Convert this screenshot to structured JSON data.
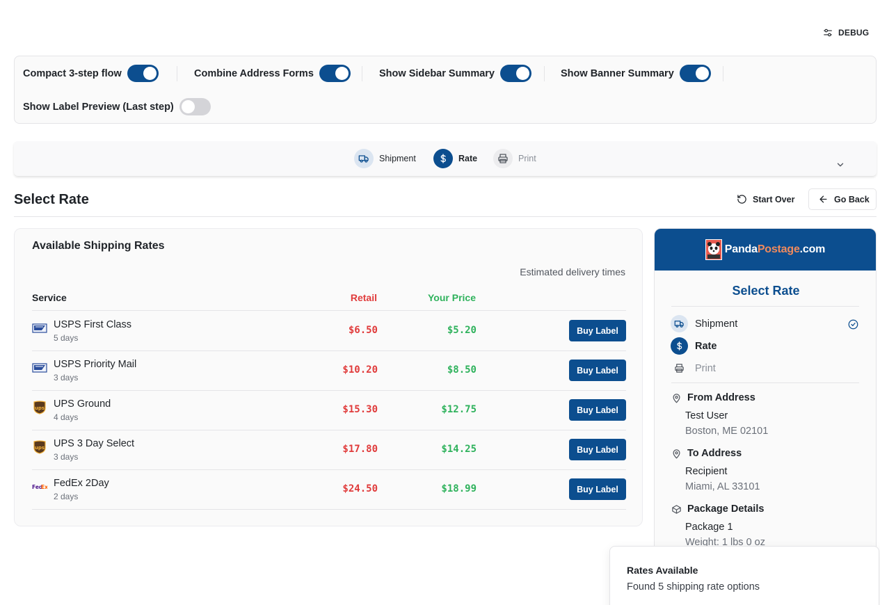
{
  "debug": {
    "label": "DEBUG",
    "icon": "sliders-icon"
  },
  "toggles": [
    {
      "label": "Compact 3-step flow",
      "on": true
    },
    {
      "label": "Combine Address Forms",
      "on": true
    },
    {
      "label": "Show Sidebar Summary",
      "on": true
    },
    {
      "label": "Show Banner Summary",
      "on": true
    },
    {
      "label": "Show Label Preview (Last step)",
      "on": false
    }
  ],
  "stepper": {
    "steps": [
      {
        "label": "Shipment",
        "state": "done",
        "icon": "truck-icon"
      },
      {
        "label": "Rate",
        "state": "active",
        "icon": "dollar-icon"
      },
      {
        "label": "Print",
        "state": "todo",
        "icon": "printer-icon"
      }
    ]
  },
  "page": {
    "title": "Select Rate",
    "start_over": "Start Over",
    "go_back": "Go Back"
  },
  "rates": {
    "title": "Available Shipping Rates",
    "estimated": "Estimated delivery times",
    "columns": {
      "service": "Service",
      "retail": "Retail",
      "your_price": "Your Price"
    },
    "rows": [
      {
        "carrier": "usps",
        "service": "USPS First Class",
        "days": "5 days",
        "retail": "$6.50",
        "price": "$5.20",
        "button": "Buy Label"
      },
      {
        "carrier": "usps",
        "service": "USPS Priority Mail",
        "days": "3 days",
        "retail": "$10.20",
        "price": "$8.50",
        "button": "Buy Label"
      },
      {
        "carrier": "ups",
        "service": "UPS Ground",
        "days": "4 days",
        "retail": "$15.30",
        "price": "$12.75",
        "button": "Buy Label"
      },
      {
        "carrier": "ups",
        "service": "UPS 3 Day Select",
        "days": "3 days",
        "retail": "$17.80",
        "price": "$14.25",
        "button": "Buy Label"
      },
      {
        "carrier": "fedex",
        "service": "FedEx 2Day",
        "days": "2 days",
        "retail": "$24.50",
        "price": "$18.99",
        "button": "Buy Label"
      }
    ]
  },
  "sidebar": {
    "logo": {
      "panda": "Panda",
      "postage": "Postage",
      "com": ".com"
    },
    "title": "Select Rate",
    "steps": [
      {
        "label": "Shipment",
        "state": "done"
      },
      {
        "label": "Rate",
        "state": "active"
      },
      {
        "label": "Print",
        "state": "todo"
      }
    ],
    "from": {
      "heading": "From Address",
      "name": "Test User",
      "city": "Boston, ME 02101"
    },
    "to": {
      "heading": "To Address",
      "name": "Recipient",
      "city": "Miami, AL 33101"
    },
    "package": {
      "heading": "Package Details",
      "name": "Package 1",
      "weight": "Weight: 1 lbs 0 oz"
    }
  },
  "toast": {
    "title": "Rates Available",
    "message": "Found 5 shipping rate options"
  },
  "colors": {
    "brand": "#0c4e8f",
    "retail": "#e03b3b",
    "price": "#2fb25c",
    "logo_accent": "#f08a5d"
  }
}
